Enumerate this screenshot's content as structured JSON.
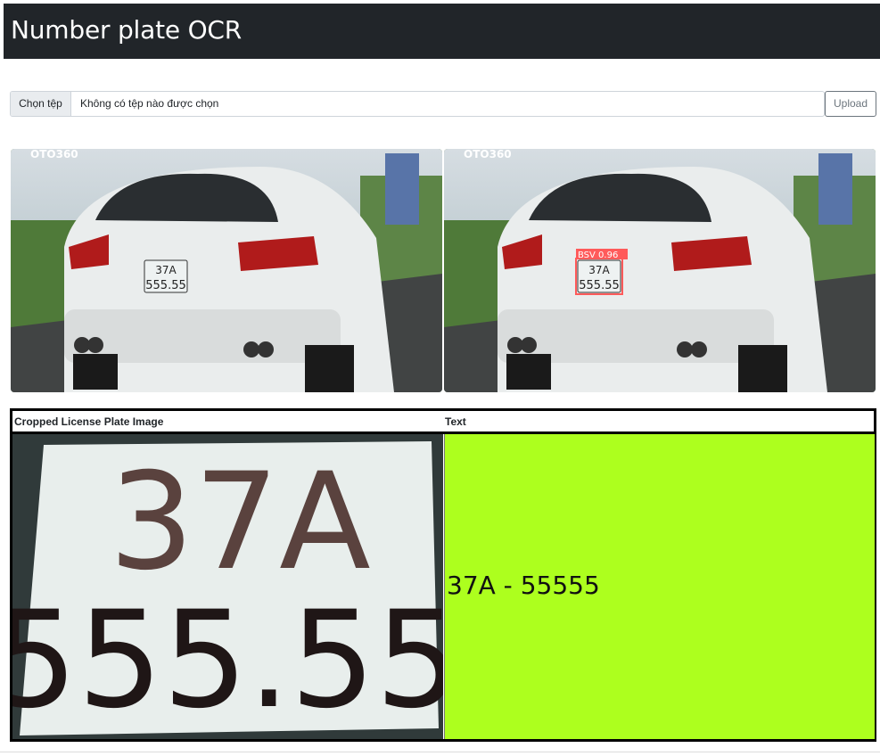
{
  "header": {
    "title": "Number plate OCR"
  },
  "upload": {
    "choose_label": "Chọn tệp",
    "file_status": "Không có tệp nào được chọn",
    "upload_label": "Upload"
  },
  "images": {
    "original": {
      "watermark": "OTO360",
      "plate_top": "37A",
      "plate_bottom": "555.55"
    },
    "detected": {
      "watermark": "OTO360",
      "detection_label": "BSV 0.96",
      "plate_top": "37A",
      "plate_bottom": "555.55"
    }
  },
  "results": {
    "headers": [
      "Cropped License Plate Image",
      "Text"
    ],
    "rows": [
      {
        "plate_top": "37A",
        "plate_bottom": "555.55",
        "text": "37A - 55555"
      }
    ]
  },
  "colors": {
    "navbar": "#212529",
    "result_bg": "#adff1e",
    "detection_box": "#ff5a5a"
  }
}
